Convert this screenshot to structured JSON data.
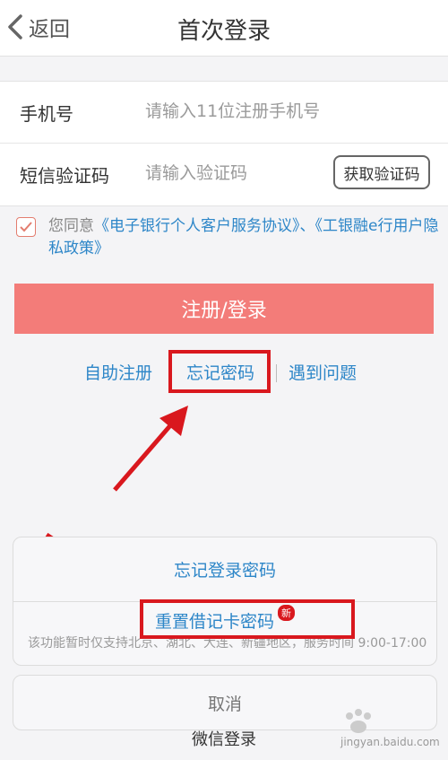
{
  "header": {
    "back_label": "返回",
    "title": "首次登录"
  },
  "form": {
    "phone_label": "手机号",
    "phone_placeholder": "请输入11位注册手机号",
    "sms_label": "短信验证码",
    "sms_placeholder": "请输入验证码",
    "get_code_button": "获取验证码"
  },
  "agreement": {
    "prefix": "您同意",
    "link1": "《电子银行个人客户服务协议》",
    "sep": "、",
    "link2": "《工银融e行用户隐私政策》",
    "checked": true
  },
  "login_button": "注册/登录",
  "links": {
    "self_register": "自助注册",
    "forgot_password": "忘记密码",
    "problem": "遇到问题"
  },
  "sheet": {
    "option1": "忘记登录密码",
    "option2": "重置借记卡密码",
    "option2_badge": "新",
    "note": "该功能暂时仅支持北京、湖北、大连、新疆地区，服务时间 9:00-17:00"
  },
  "cancel_button": "取消",
  "wechat_login": "微信登录",
  "watermark": "jingyan.baidu.com",
  "colors": {
    "accent_blue": "#2d86c8",
    "login_button": "#f37c79",
    "annotation_red": "#d9181e"
  }
}
